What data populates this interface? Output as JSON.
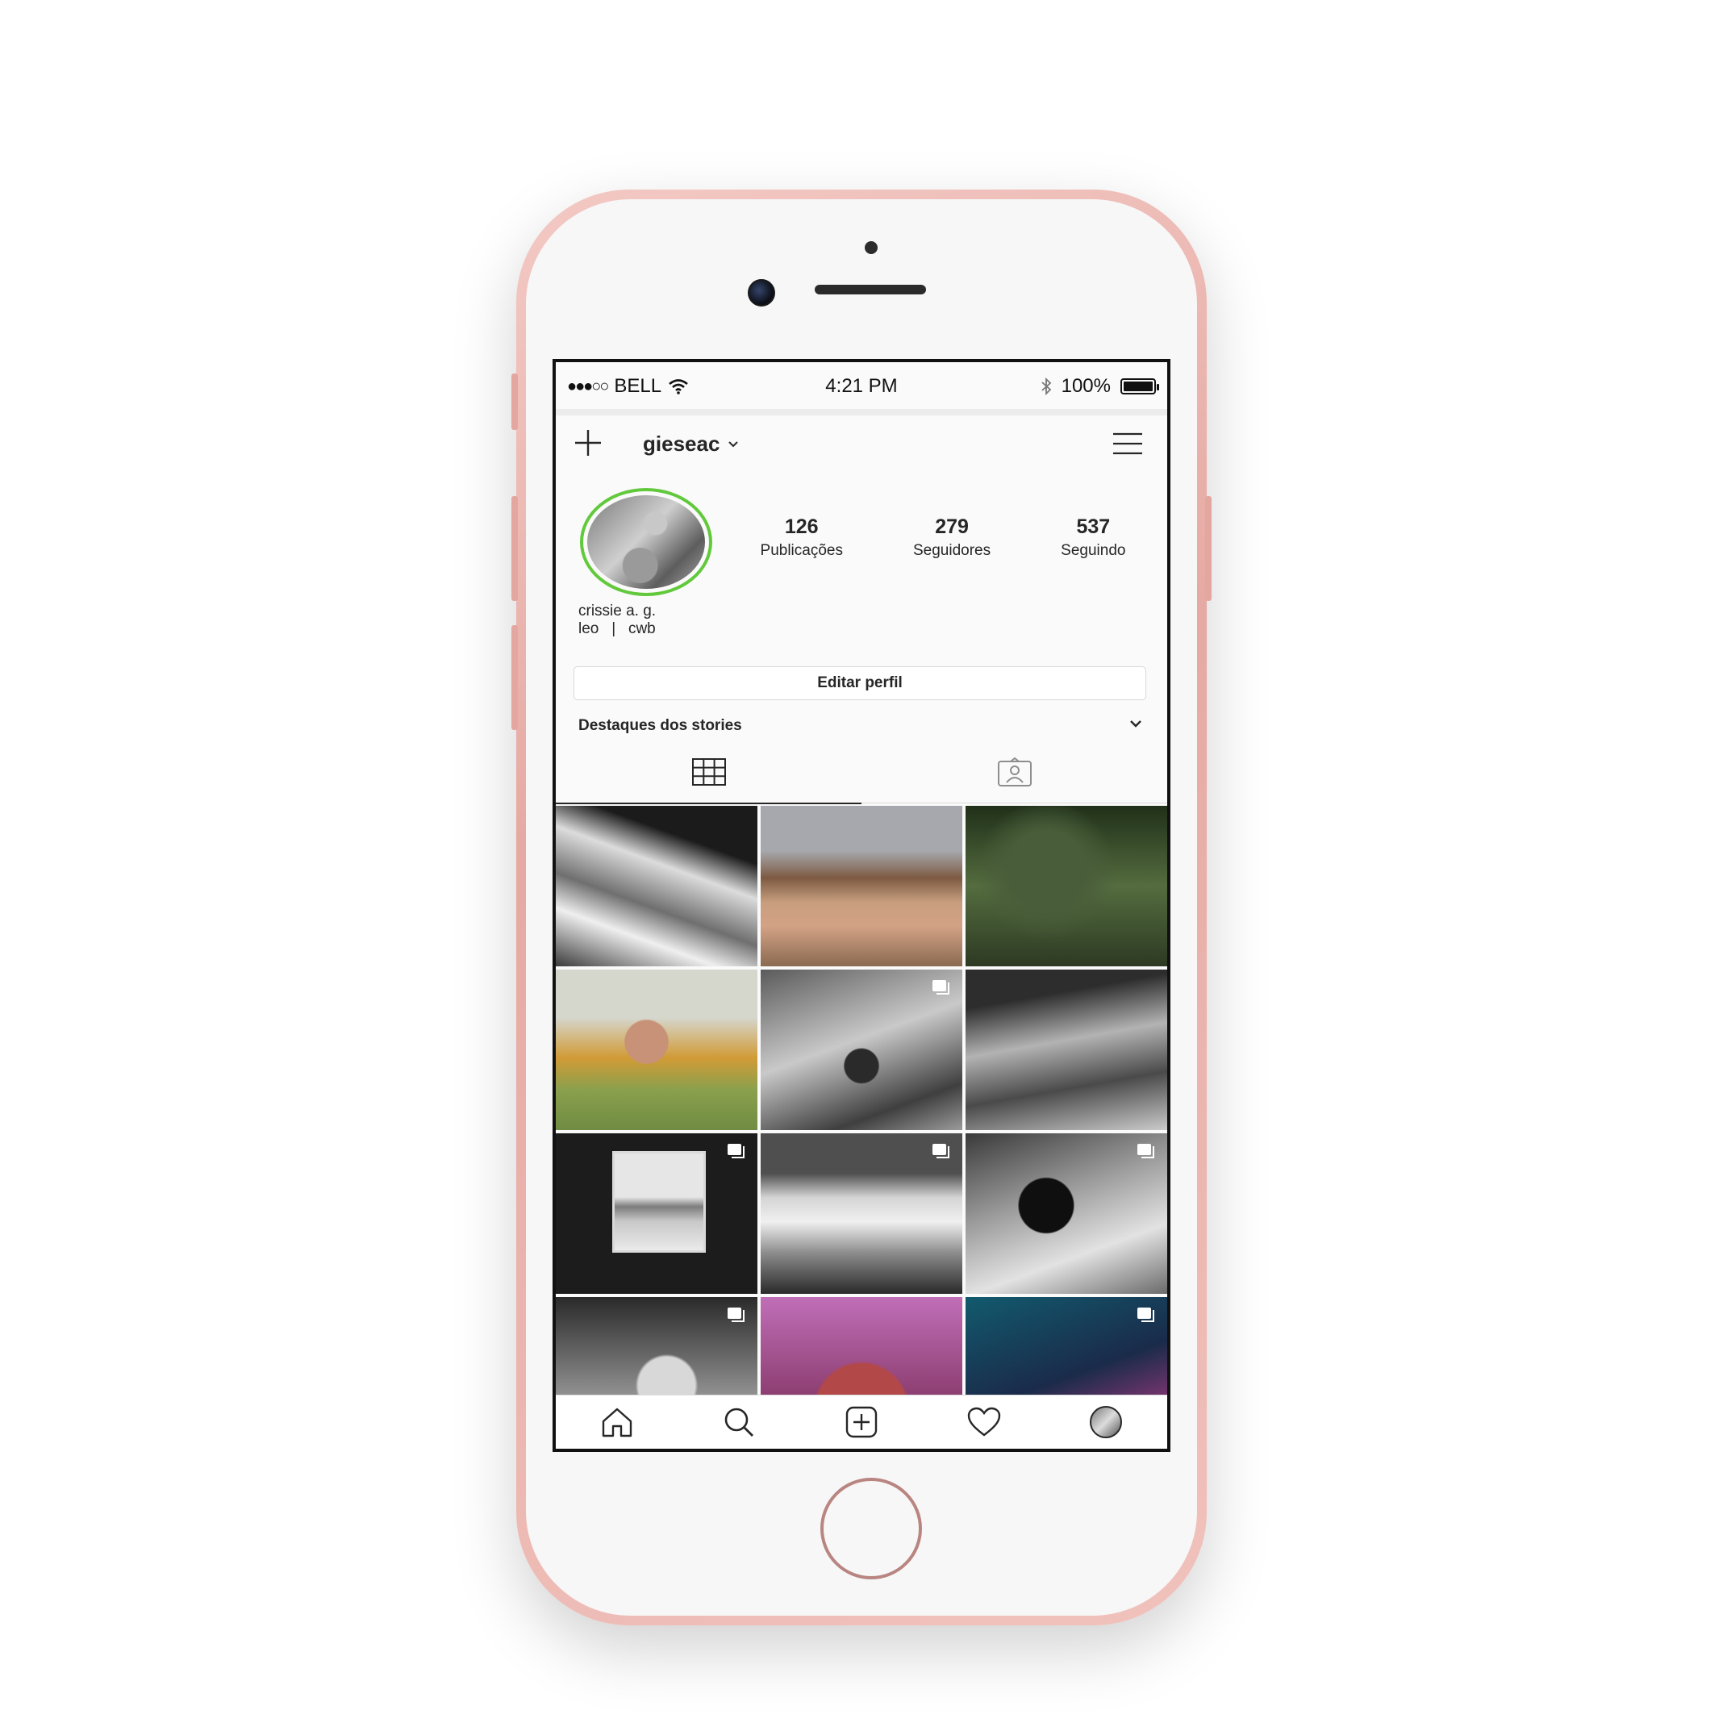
{
  "status_bar": {
    "signal": "●●●○○",
    "carrier": "BELL",
    "time": "4:21 PM",
    "battery": "100%"
  },
  "header": {
    "username": "gieseac"
  },
  "profile": {
    "stats": [
      {
        "number": "126",
        "label": "Publicações"
      },
      {
        "number": "279",
        "label": "Seguidores"
      },
      {
        "number": "537",
        "label": "Seguindo"
      }
    ],
    "name": "crissie a. g.",
    "bio": "leo   |   cwb",
    "edit_button": "Editar perfil",
    "highlights_label": "Destaques dos stories"
  },
  "tabs": {
    "grid_icon": "grid-icon",
    "tagged_icon": "tagged-person-icon"
  },
  "grid": {
    "photos": [
      {
        "multi": false
      },
      {
        "multi": false
      },
      {
        "multi": false
      },
      {
        "multi": false
      },
      {
        "multi": true
      },
      {
        "multi": false
      },
      {
        "multi": true
      },
      {
        "multi": true
      },
      {
        "multi": true
      },
      {
        "multi": true
      },
      {
        "multi": false
      },
      {
        "multi": true
      }
    ]
  },
  "bottom_nav": {
    "items": [
      "home-icon",
      "search-icon",
      "new-post-icon",
      "heart-icon",
      "profile-avatar"
    ]
  },
  "colors": {
    "phone_frame": "#e6a9a3",
    "story_ring": "#62c93c",
    "text": "#262626"
  }
}
